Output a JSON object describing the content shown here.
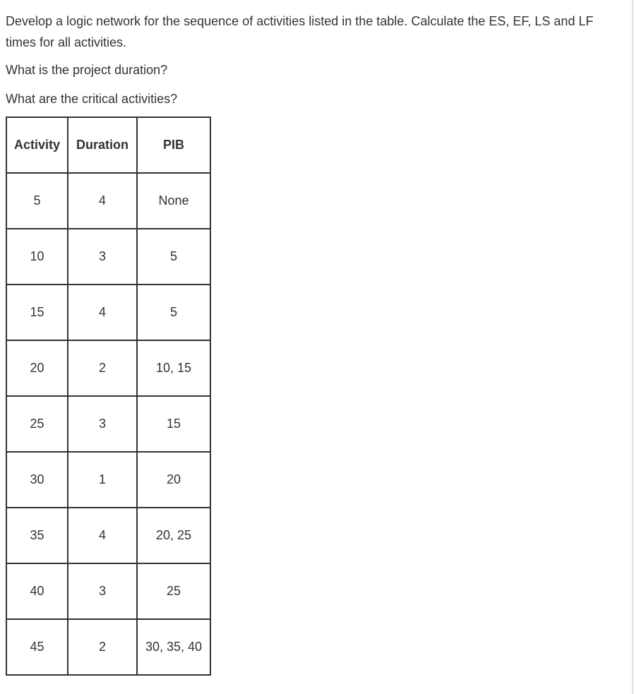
{
  "question": {
    "paragraph1": "Develop a logic network for the sequence of activities listed in the table. Calculate the ES, EF, LS and LF times for all activities.",
    "paragraph2": "What is the project duration?",
    "paragraph3": "What are the critical activities?"
  },
  "table": {
    "headers": [
      "Activity",
      "Duration",
      "PIB"
    ],
    "rows": [
      [
        "5",
        "4",
        "None"
      ],
      [
        "10",
        "3",
        "5"
      ],
      [
        "15",
        "4",
        "5"
      ],
      [
        "20",
        "2",
        "10, 15"
      ],
      [
        "25",
        "3",
        "15"
      ],
      [
        "30",
        "1",
        "20"
      ],
      [
        "35",
        "4",
        "20, 25"
      ],
      [
        "40",
        "3",
        "25"
      ],
      [
        "45",
        "2",
        "30, 35, 40"
      ]
    ]
  }
}
